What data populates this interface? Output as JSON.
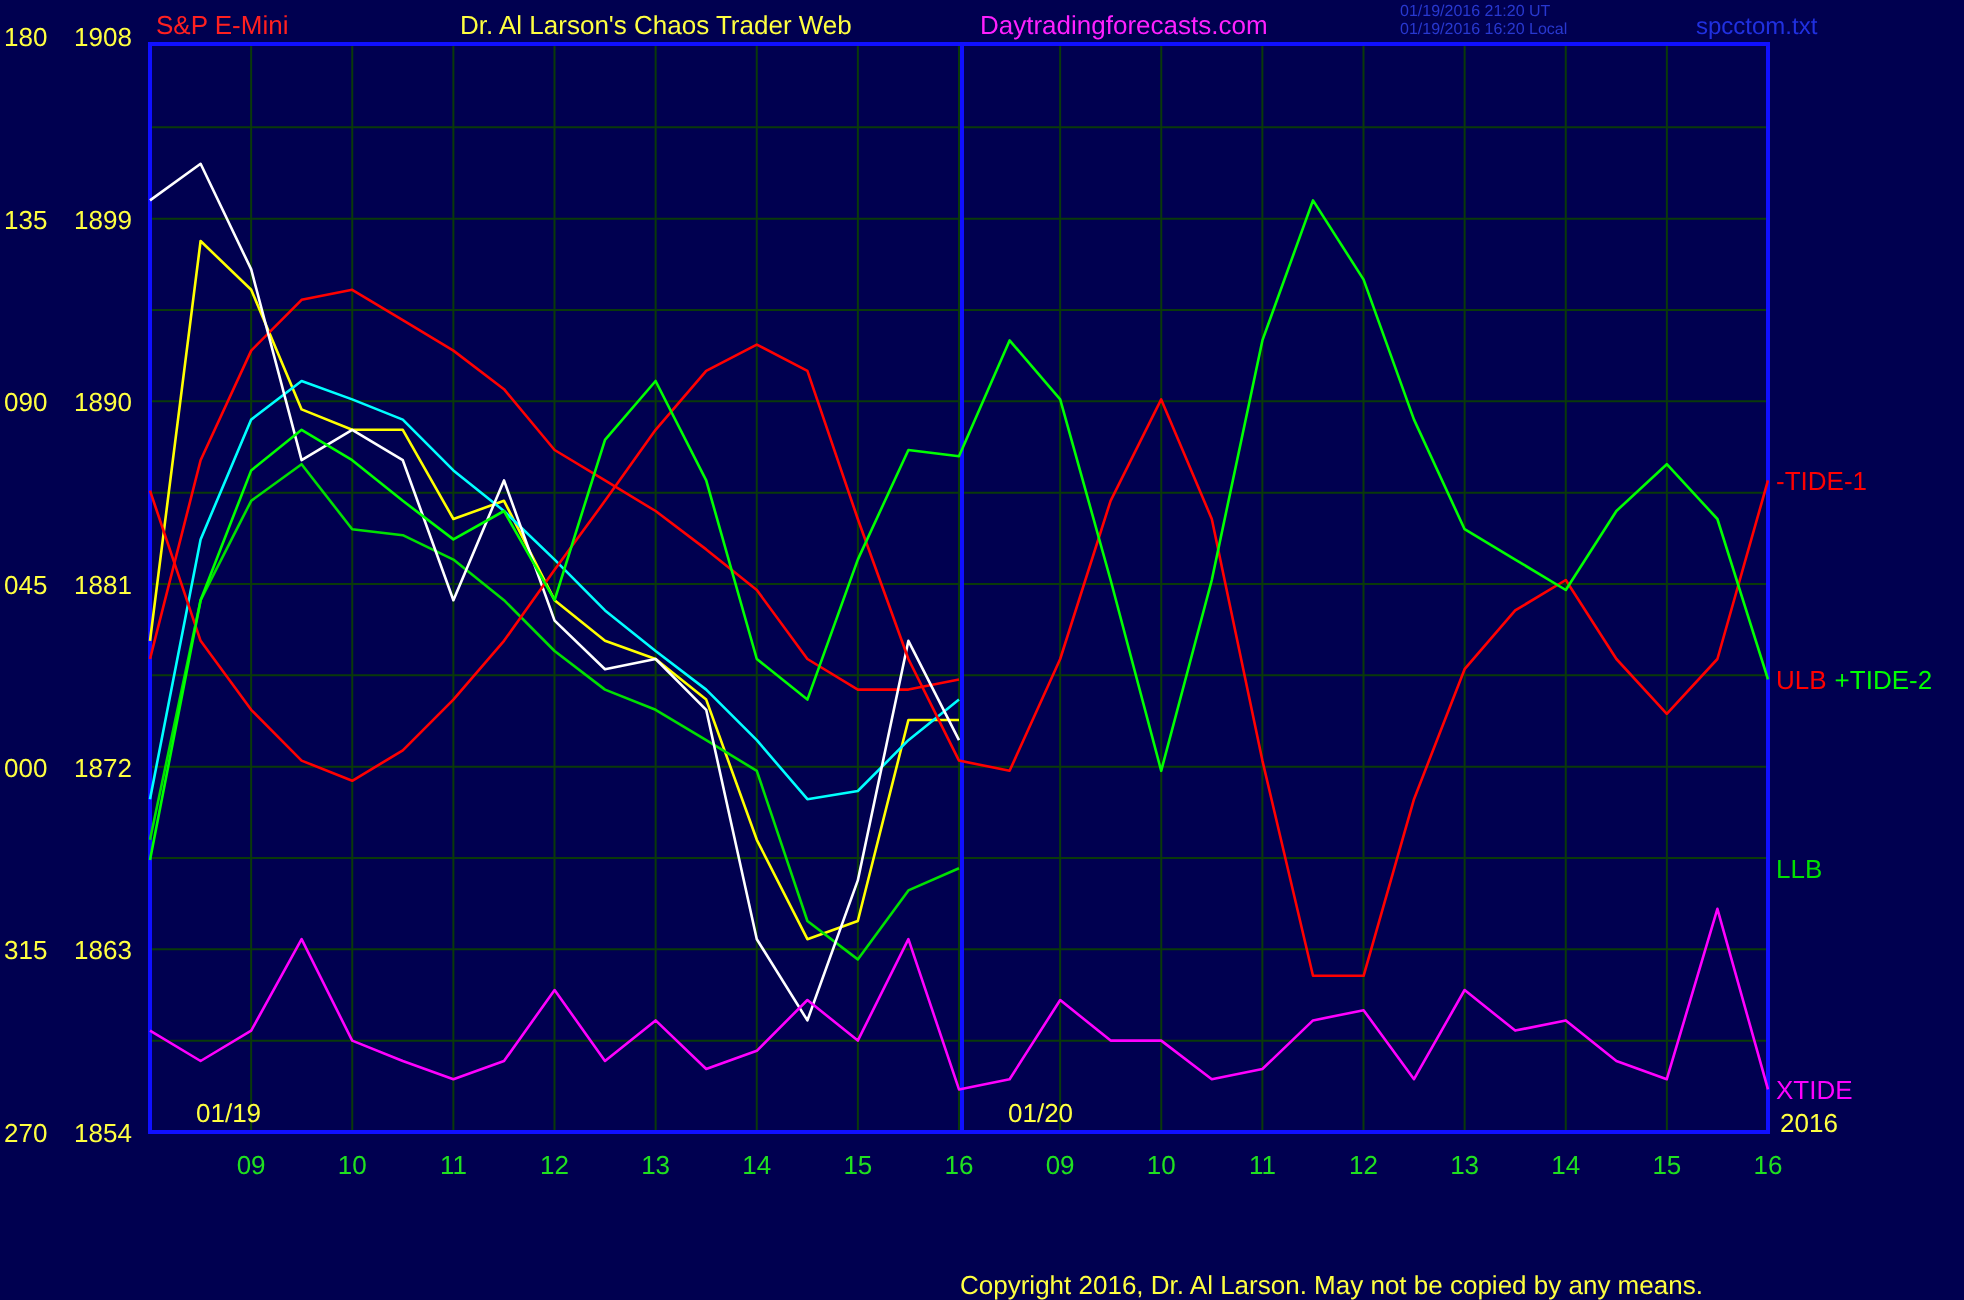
{
  "header": {
    "symbol": "S&P E-Mini",
    "title": "Dr. Al Larson's Chaos Trader Web",
    "site": "Daytradingforecasts.com",
    "timestamps": [
      "01/19/2016 21:20 UT",
      "01/19/2016 16:20 Local"
    ],
    "file": "spcctom.txt"
  },
  "chart": {
    "degree_labels": [
      "180",
      "135",
      "090",
      "045",
      "000",
      "315",
      "270"
    ],
    "year": "2016",
    "days": [
      {
        "date": "01/19"
      },
      {
        "date": "01/20"
      }
    ],
    "chart_data": {
      "type": "line",
      "categories": [
        null,
        null,
        "09",
        null,
        "10",
        null,
        "11",
        null,
        "12",
        null,
        "13",
        null,
        "14",
        null,
        "15",
        null,
        "16",
        null,
        "09",
        null,
        "10",
        null,
        "11",
        null,
        "12",
        null,
        "13",
        null,
        "14",
        null,
        "15",
        null,
        "16"
      ],
      "grid": true,
      "ylim": [
        1854,
        1908
      ],
      "yticks": [
        1854,
        1863,
        1872,
        1881,
        1890,
        1899,
        1908
      ],
      "series": [
        {
          "color": "#ffff00",
          "values": [
            1878.2,
            1897.9,
            1895.5,
            1889.6,
            1888.6,
            1888.6,
            1884.2,
            1885.1,
            1880.2,
            1878.2,
            1877.3,
            1875.3,
            1868.4,
            1863.5,
            1864.4,
            1874.3,
            1874.3,
            null,
            null,
            null,
            null,
            null,
            null,
            null,
            null,
            null,
            null,
            null,
            null,
            null,
            null,
            null,
            null
          ]
        },
        {
          "color": "#00ffff",
          "values": [
            1870.4,
            1883.2,
            1889.1,
            1891.0,
            1890.1,
            1889.1,
            1886.6,
            1884.6,
            1882.2,
            1879.7,
            1877.7,
            1875.8,
            1873.3,
            1870.4,
            1870.8,
            1873.3,
            1875.3,
            null,
            null,
            null,
            null,
            null,
            null,
            null,
            null,
            null,
            null,
            null,
            null,
            null,
            null,
            null,
            null
          ]
        },
        {
          "name": "ULB",
          "color": "#ff0000",
          "values": [
            1877.3,
            1887.1,
            1892.5,
            1895.0,
            1895.5,
            1894.0,
            1892.5,
            1890.6,
            1887.6,
            1886.1,
            1884.6,
            1882.7,
            1880.7,
            1877.3,
            1875.8,
            1875.8,
            1876.3,
            null,
            null,
            null,
            null,
            null,
            null,
            null,
            null,
            null,
            null,
            null,
            null,
            null,
            null,
            null,
            null
          ]
        },
        {
          "name": "LLB",
          "color": "#00e000",
          "values": [
            1868.4,
            1880.2,
            1885.1,
            1886.9,
            1883.7,
            1883.4,
            1882.2,
            1880.2,
            1877.7,
            1875.8,
            1874.8,
            1873.3,
            1871.8,
            1864.4,
            1862.5,
            1865.9,
            1867.0,
            null,
            null,
            null,
            null,
            null,
            null,
            null,
            null,
            null,
            null,
            null,
            null,
            null,
            null,
            null,
            null
          ]
        },
        {
          "color": "#ffffff",
          "values": [
            1899.9,
            1901.7,
            1896.5,
            1887.1,
            1888.6,
            1887.1,
            1880.2,
            1886.1,
            1879.2,
            1876.8,
            1877.3,
            1874.8,
            1863.5,
            1859.5,
            1866.4,
            1878.2,
            1873.3,
            null,
            null,
            null,
            null,
            null,
            null,
            null,
            null,
            null,
            null,
            null,
            null,
            null,
            null,
            null,
            null
          ]
        },
        {
          "name": "-TIDE-1",
          "color": "#ff0000",
          "values": [
            1885.6,
            1878.2,
            1874.8,
            1872.3,
            1871.3,
            1872.8,
            1875.3,
            1878.2,
            1881.7,
            1885.1,
            1888.6,
            1891.5,
            1892.8,
            1891.5,
            1884.2,
            1877.3,
            1872.3,
            1871.8,
            1877.3,
            1885.1,
            1890.1,
            1884.2,
            1872.3,
            1861.7,
            1861.7,
            1870.4,
            1876.8,
            1879.7,
            1881.2,
            1877.3,
            1874.6,
            1877.3,
            1886.1
          ]
        },
        {
          "name": "+TIDE-2",
          "color": "#00ff00",
          "values": [
            1867.4,
            1880.2,
            1886.6,
            1888.6,
            1887.1,
            1885.1,
            1883.2,
            1884.6,
            1880.2,
            1888.1,
            1891.0,
            1886.1,
            1877.3,
            1875.3,
            1882.2,
            1887.6,
            1887.3,
            1893.0,
            1890.1,
            1881.2,
            1871.8,
            1881.2,
            1893.0,
            1899.9,
            1896.0,
            1889.1,
            1883.7,
            1882.2,
            1880.7,
            1884.6,
            1886.9,
            1884.2,
            1876.3
          ]
        },
        {
          "name": "XTIDE",
          "color": "#ff00ff",
          "values": [
            1859.0,
            1857.5,
            1859.0,
            1863.5,
            1858.5,
            1857.5,
            1856.6,
            1857.5,
            1861.0,
            1857.5,
            1859.5,
            1857.1,
            1858.0,
            1860.5,
            1858.5,
            1863.5,
            1856.1,
            1856.6,
            1860.5,
            1858.5,
            1858.5,
            1856.6,
            1857.1,
            1859.5,
            1860.0,
            1856.6,
            1861.0,
            1859.0,
            1859.5,
            1857.5,
            1856.6,
            1865.0,
            1856.1
          ]
        }
      ]
    }
  },
  "copyright": "Copyright 2016, Dr. Al Larson. May not be copied by any means."
}
